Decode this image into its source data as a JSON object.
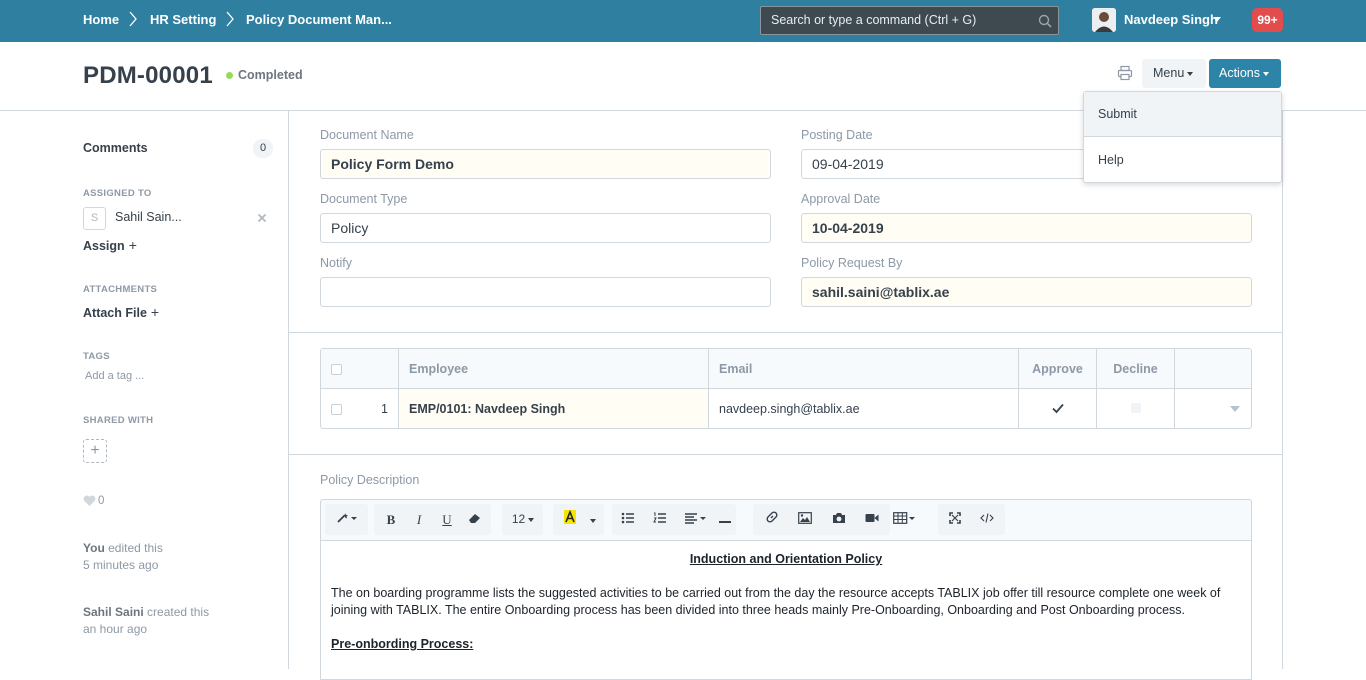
{
  "navbar": {
    "breadcrumbs": [
      "Home",
      "HR Setting",
      "Policy Document Man..."
    ],
    "search_placeholder": "Search or type a command (Ctrl + G)",
    "user_name": "Navdeep Singh",
    "notifications": "99+"
  },
  "page_head": {
    "title": "PDM-00001",
    "status": "Completed",
    "menu_label": "Menu",
    "actions_label": "Actions"
  },
  "actions_dropdown": {
    "items": [
      "Submit",
      "Help"
    ]
  },
  "sidebar": {
    "comments_label": "Comments",
    "comments_count": "0",
    "assigned_to_label": "ASSIGNED TO",
    "assignee_initial": "S",
    "assignee_name": "Sahil Sain...",
    "assign_label": "Assign",
    "attachments_label": "ATTACHMENTS",
    "attach_file_label": "Attach File",
    "tags_label": "TAGS",
    "add_tag_placeholder": "Add a tag ...",
    "shared_with_label": "SHARED WITH",
    "likes": "0",
    "timeline": [
      {
        "actor": "You",
        "action": "edited this",
        "time": "5 minutes ago"
      },
      {
        "actor": "Sahil Saini",
        "action": "created this",
        "time": "an hour ago"
      }
    ]
  },
  "form": {
    "document_name": {
      "label": "Document Name",
      "value": "Policy Form Demo"
    },
    "posting_date": {
      "label": "Posting Date",
      "value": "09-04-2019"
    },
    "document_type": {
      "label": "Document Type",
      "value": "Policy"
    },
    "approval_date": {
      "label": "Approval Date",
      "value": "10-04-2019"
    },
    "notify": {
      "label": "Notify",
      "value": ""
    },
    "policy_request_by": {
      "label": "Policy Request By",
      "value": "sahil.saini@tablix.ae"
    }
  },
  "grid": {
    "headers": [
      "Employee",
      "Email",
      "Approve",
      "Decline"
    ],
    "rows": [
      {
        "no": "1",
        "employee": "EMP/0101: Navdeep Singh",
        "email": "navdeep.singh@tablix.ae",
        "approve": true,
        "decline": false
      }
    ]
  },
  "editor": {
    "label": "Policy Description",
    "font_size": "12",
    "title": "Induction and Orientation Policy",
    "paragraph": "The on boarding programme lists the suggested activities to be carried out from the day the resource accepts TABLIX job offer till resource complete one week of joining with TABLIX. The entire Onboarding process has been divided into three heads mainly Pre-Onboarding, Onboarding and Post Onboarding process.",
    "subheading": "Pre-onbording Process:"
  },
  "colors": {
    "navbar": "#2f7fa0",
    "primary_button": "#2c84a8",
    "status_dot": "#98d85b",
    "badge": "#e24c4c"
  }
}
